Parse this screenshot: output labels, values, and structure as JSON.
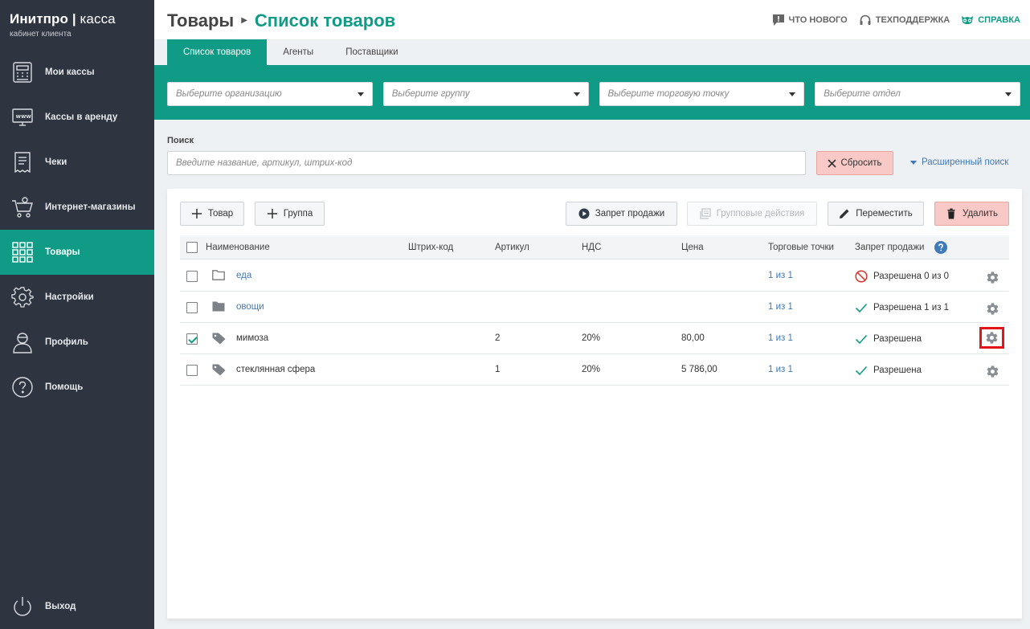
{
  "brand": {
    "title": "Инитпро",
    "title_thin": "касса",
    "subtitle": "кабинет клиента"
  },
  "sidebar": {
    "items": [
      {
        "label": "Мои кассы",
        "icon": "cash-register-icon"
      },
      {
        "label": "Кассы в аренду",
        "icon": "monitor-www-icon"
      },
      {
        "label": "Чеки",
        "icon": "receipt-icon"
      },
      {
        "label": "Интернет-магазины",
        "icon": "shopping-cart-icon"
      },
      {
        "label": "Товары",
        "icon": "grid-icon",
        "active": true
      },
      {
        "label": "Настройки",
        "icon": "gear-icon"
      },
      {
        "label": "Профиль",
        "icon": "user-icon"
      },
      {
        "label": "Помощь",
        "icon": "question-icon"
      }
    ],
    "logout": "Выход"
  },
  "header": {
    "title": "Товары",
    "current": "Список товаров",
    "links": {
      "whats_new": "ЧТО НОВОГО",
      "support": "ТЕХПОДДЕРЖКА",
      "help": "СПРАВКА"
    }
  },
  "tabs": [
    "Список товаров",
    "Агенты",
    "Поставщики"
  ],
  "filters": {
    "organization": "Выберите организацию",
    "group": "Выберите группу",
    "point": "Выберите торговую точку",
    "department": "Выберите отдел"
  },
  "search": {
    "label": "Поиск",
    "placeholder": "Введите название, артикул, штрих-код",
    "reset": "Сбросить",
    "advanced": "Расширенный поиск"
  },
  "toolbar": {
    "add_product": "Товар",
    "add_group": "Группа",
    "ban_sale": "Запрет продажи",
    "group_actions": "Групповые действия",
    "move": "Переместить",
    "delete": "Удалить"
  },
  "table": {
    "columns": {
      "name": "Наименование",
      "barcode": "Штрих-код",
      "article": "Артикул",
      "vat": "НДС",
      "price": "Цена",
      "points": "Торговые точки",
      "ban": "Запрет продажи"
    },
    "rows": [
      {
        "type": "folder-open",
        "name": "еда",
        "barcode": "",
        "article": "",
        "vat": "",
        "price": "",
        "points": "1 из 1",
        "status": "Разрешена 0 из 0",
        "status_icon": "forbidden",
        "checked": false
      },
      {
        "type": "folder",
        "name": "овощи",
        "barcode": "",
        "article": "",
        "vat": "",
        "price": "",
        "points": "1 из 1",
        "status": "Разрешена 1 из 1",
        "status_icon": "check",
        "checked": false
      },
      {
        "type": "product",
        "name": "мимоза",
        "barcode": "",
        "article": "2",
        "vat": "20%",
        "price": "80,00",
        "points": "1 из 1",
        "status": "Разрешена",
        "status_icon": "check",
        "checked": true
      },
      {
        "type": "product",
        "name": "стеклянная сфера",
        "barcode": "",
        "article": "1",
        "vat": "20%",
        "price": "5 786,00",
        "points": "1 из 1",
        "status": "Разрешена",
        "status_icon": "check",
        "checked": false
      }
    ]
  },
  "colors": {
    "accent": "#109b86",
    "sidebar": "#2e3440",
    "link": "#3f79b8",
    "danger_bg": "#f8c9c6",
    "highlight": "#e3151a"
  }
}
